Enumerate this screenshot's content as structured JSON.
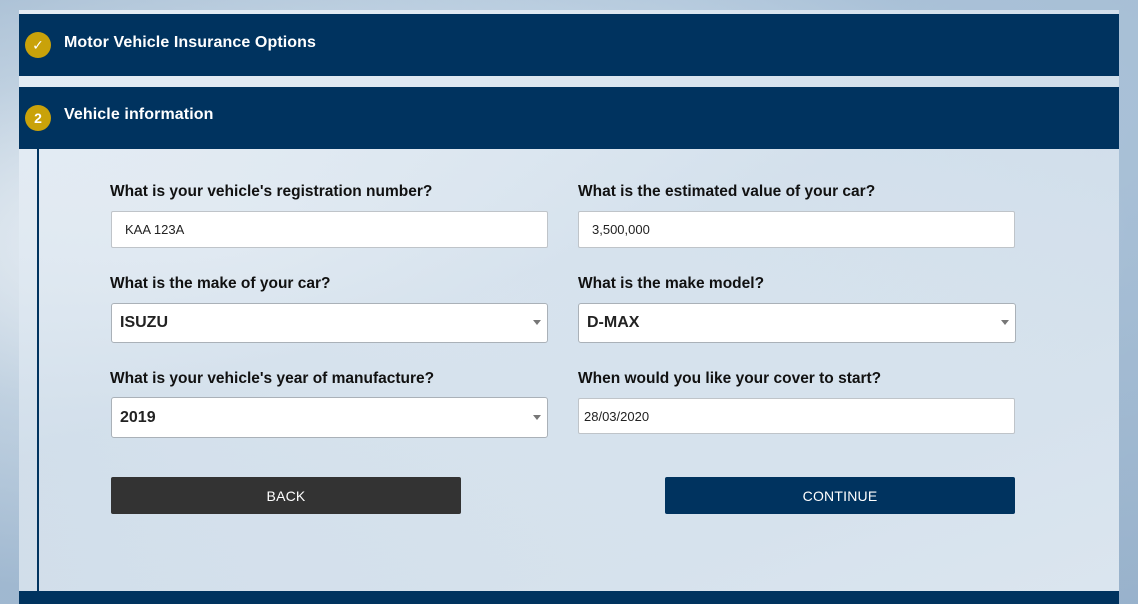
{
  "steps": [
    {
      "badge": "✓",
      "title": "Motor Vehicle Insurance Options",
      "status": "completed"
    },
    {
      "badge": "2",
      "title": "Vehicle information",
      "status": "active"
    }
  ],
  "form": {
    "registration": {
      "label": "What is your vehicle's registration number?",
      "value": "KAA 123A"
    },
    "estimated_value": {
      "label": "What is the estimated value of your car?",
      "value": "3,500,000"
    },
    "make": {
      "label": "What is the make of your car?",
      "selected": "ISUZU"
    },
    "model": {
      "label": "What is the make model?",
      "selected": "D-MAX"
    },
    "year": {
      "label": "What is your vehicle's year of manufacture?",
      "selected": "2019"
    },
    "cover_start": {
      "label": "When would you like your cover to start?",
      "value": "28/03/2020"
    }
  },
  "buttons": {
    "back": "BACK",
    "continue": "CONTINUE"
  },
  "colors": {
    "header": "#00335f",
    "badge": "#c9a20a",
    "back_button": "#333333",
    "continue_button": "#00335f"
  }
}
